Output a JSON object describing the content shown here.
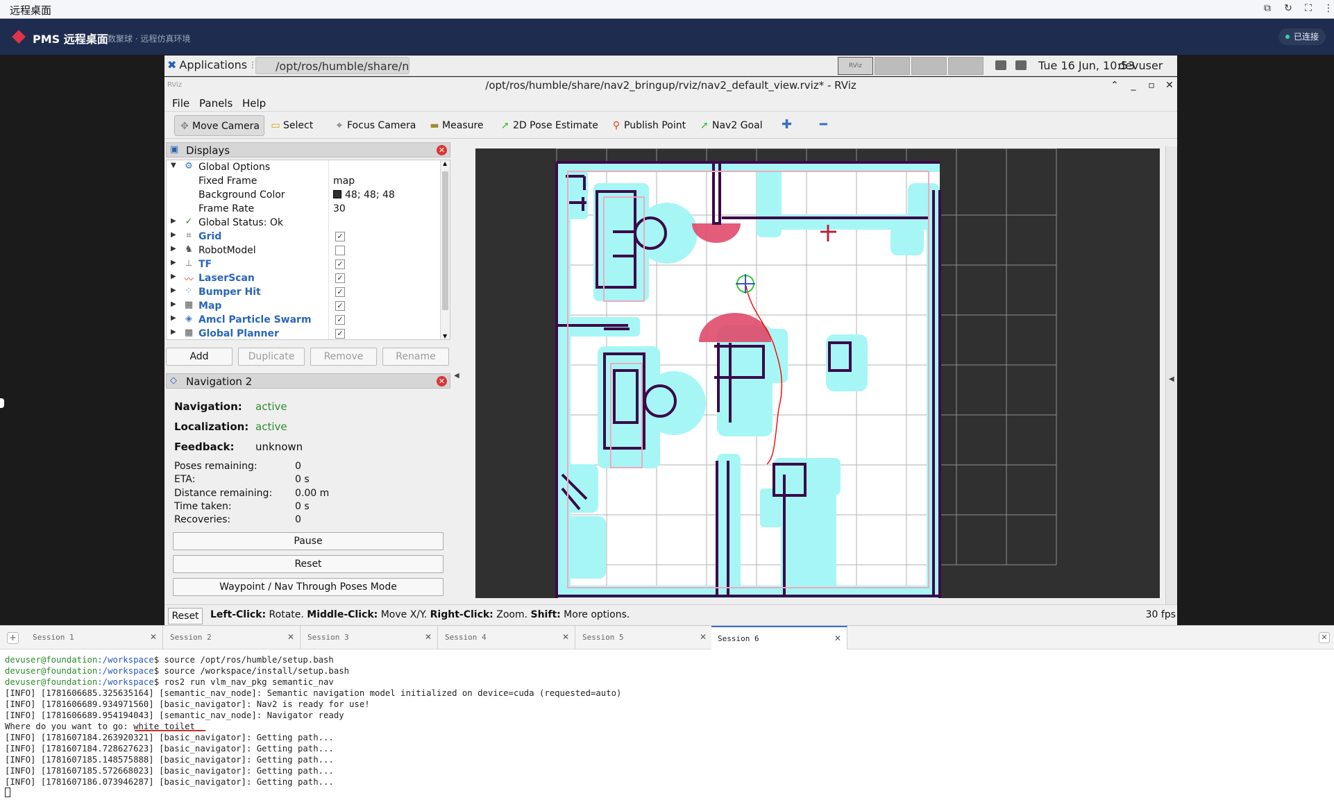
{
  "topbar": {
    "title": "远程桌面"
  },
  "header": {
    "brand": "PMS 远程桌面",
    "subtitle": "数聚球 · 远程仿真环境",
    "connection_status": "已连接"
  },
  "xfce_panel": {
    "applications_label": "Applications",
    "task_label": "/opt/ros/humble/share/n...",
    "workspace_label": "RViz",
    "clock": "Tue 16 Jun, 10:53",
    "user": "devuser"
  },
  "window": {
    "title": "/opt/ros/humble/share/nav2_bringup/rviz/nav2_default_view.rviz* - RViz"
  },
  "menu": {
    "file": "File",
    "panels": "Panels",
    "help": "Help"
  },
  "toolbar": {
    "move_camera": "Move Camera",
    "select": "Select",
    "focus_camera": "Focus Camera",
    "measure": "Measure",
    "pose_estimate": "2D Pose Estimate",
    "publish_point": "Publish Point",
    "nav2_goal": "Nav2 Goal"
  },
  "displays": {
    "title": "Displays",
    "global_options": "Global Options",
    "fixed_frame_label": "Fixed Frame",
    "fixed_frame_value": "map",
    "bg_color_label": "Background Color",
    "bg_color_value": "48; 48; 48",
    "frame_rate_label": "Frame Rate",
    "frame_rate_value": "30",
    "global_status": "Global Status: Ok",
    "items": [
      {
        "name": "Grid",
        "checked": true
      },
      {
        "name": "RobotModel",
        "checked": false
      },
      {
        "name": "TF",
        "checked": true
      },
      {
        "name": "LaserScan",
        "checked": true
      },
      {
        "name": "Bumper Hit",
        "checked": true
      },
      {
        "name": "Map",
        "checked": true
      },
      {
        "name": "Amcl Particle Swarm",
        "checked": true
      },
      {
        "name": "Global Planner",
        "checked": true
      }
    ],
    "buttons": {
      "add": "Add",
      "duplicate": "Duplicate",
      "remove": "Remove",
      "rename": "Rename"
    }
  },
  "nav2": {
    "title": "Navigation 2",
    "navigation_label": "Navigation:",
    "navigation_value": "active",
    "localization_label": "Localization:",
    "localization_value": "active",
    "feedback_label": "Feedback:",
    "feedback_value": "unknown",
    "poses_remaining_label": "Poses remaining:",
    "poses_remaining_value": "0",
    "eta_label": "ETA:",
    "eta_value": "0 s",
    "distance_label": "Distance remaining:",
    "distance_value": "0.00 m",
    "time_taken_label": "Time taken:",
    "time_taken_value": "0 s",
    "recoveries_label": "Recoveries:",
    "recoveries_value": "0",
    "pause": "Pause",
    "reset": "Reset",
    "waypoint_mode": "Waypoint / Nav Through Poses Mode"
  },
  "statusbar": {
    "reset": "Reset",
    "left_click": "Left-Click:",
    "left_click_desc": " Rotate. ",
    "middle_click": "Middle-Click:",
    "middle_click_desc": " Move X/Y. ",
    "right_click": "Right-Click:",
    "right_click_desc": " Zoom. ",
    "shift": "Shift:",
    "shift_desc": " More options.",
    "fps": "30 fps"
  },
  "terminal_tabs": [
    "Session 1",
    "Session 2",
    "Session 3",
    "Session 4",
    "Session 5",
    "Session 6"
  ],
  "terminal": {
    "user_host": "devuser@foundation",
    "path": ":/workspace",
    "cmd1": "$ source /opt/ros/humble/setup.bash",
    "cmd2": "$ source /workspace/install/setup.bash",
    "cmd3": "$ ros2 run vlm_nav_pkg semantic_nav",
    "log1": "[INFO] [1781606685.325635164] [semantic_nav_node]: Semantic navigation model initialized on device=cuda (requested=auto)",
    "log2": "[INFO] [1781606689.934971560] [basic_navigator]: Nav2 is ready for use!",
    "log3": "[INFO] [1781606689.954194043] [semantic_nav_node]: Navigator ready",
    "prompt_question": "Where do you want to go: ",
    "prompt_answer": "white toilet",
    "log4": "[INFO] [1781607184.263920321] [basic_navigator]: Getting path...",
    "log5": "[INFO] [1781607184.728627623] [basic_navigator]: Getting path...",
    "log6": "[INFO] [1781607185.148575888] [basic_navigator]: Getting path...",
    "log7": "[INFO] [1781607185.572668023] [basic_navigator]: Getting path...",
    "log8": "[INFO] [1781607186.073946287] [basic_navigator]: Getting path..."
  },
  "colors": {
    "header_bg": "#1e2d4f",
    "accent": "#e0334a",
    "viewport_bg": "#303030",
    "map_free": "#ffffff",
    "map_inflation": "#a6f6f6",
    "map_wall": "#3b0a4a",
    "costmap_high": "#e04a6a",
    "path": "#ff0000"
  }
}
